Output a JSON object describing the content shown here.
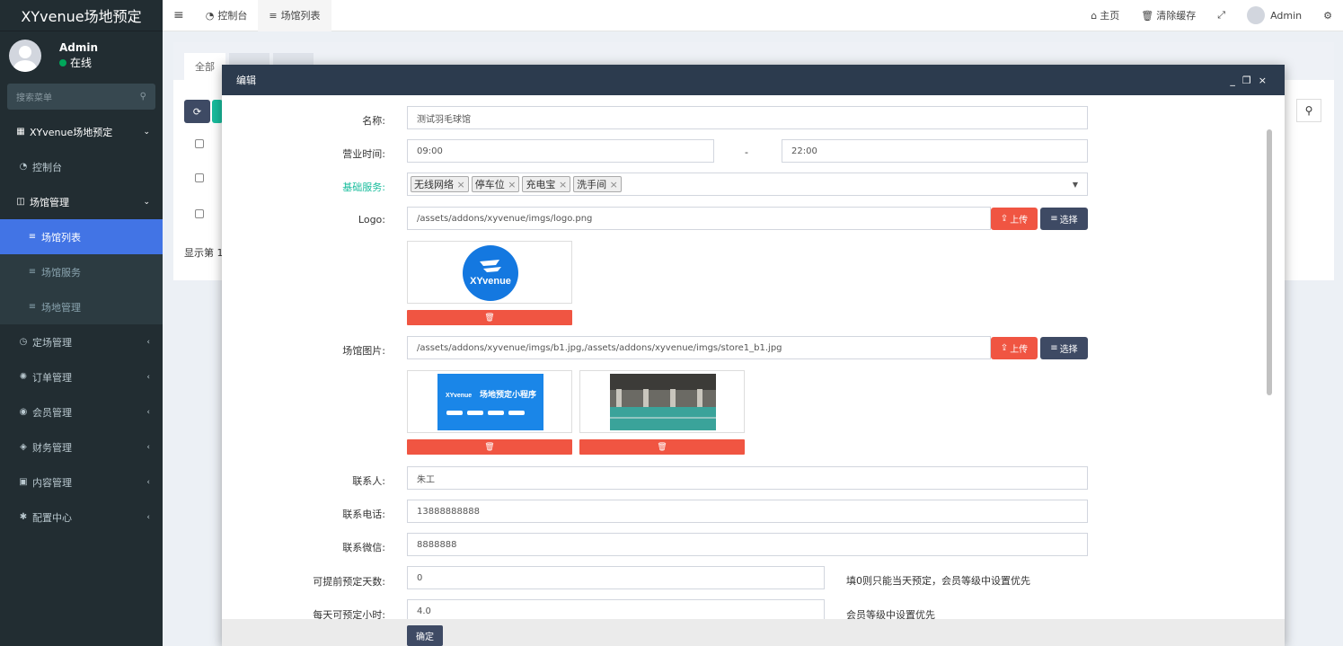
{
  "sidebar": {
    "brand": "XYvenue场地预定",
    "user_name": "Admin",
    "user_status": "在线",
    "search_placeholder": "搜索菜单",
    "items": [
      {
        "label": "XYvenue场地预定",
        "icon": "grid-icon"
      },
      {
        "label": "控制台",
        "icon": "dashboard-icon"
      },
      {
        "label": "场馆管理",
        "icon": "columns-icon"
      },
      {
        "label": "场馆列表",
        "icon": "list-icon"
      },
      {
        "label": "场馆服务",
        "icon": "list-icon"
      },
      {
        "label": "场地管理",
        "icon": "list-icon"
      },
      {
        "label": "定场管理",
        "icon": "clock-icon"
      },
      {
        "label": "订单管理",
        "icon": "gear-icon"
      },
      {
        "label": "会员管理",
        "icon": "user-icon"
      },
      {
        "label": "财务管理",
        "icon": "diamond-icon"
      },
      {
        "label": "内容管理",
        "icon": "edit-icon"
      },
      {
        "label": "配置中心",
        "icon": "cog-icon"
      }
    ]
  },
  "topbar": {
    "menu_icon": "≡",
    "tabs": [
      "控制台",
      "场馆列表"
    ],
    "home": "主页",
    "clear_cache": "清除缓存",
    "admin": "Admin"
  },
  "content": {
    "tab_all": "全部",
    "pager_text": "显示第 1"
  },
  "modal": {
    "title": "编辑",
    "fields": {
      "name_label": "名称:",
      "name_value": "测试羽毛球馆",
      "hours_label": "营业时间:",
      "hours_start": "09:00",
      "hours_sep": "-",
      "hours_end": "22:00",
      "services_label": "基础服务:",
      "services": [
        "无线网络",
        "停车位",
        "充电宝",
        "洗手间"
      ],
      "logo_label": "Logo:",
      "logo_value": "/assets/addons/xyvenue/imgs/logo.png",
      "logo_text": "XYvenue",
      "images_label": "场馆图片:",
      "images_value": "/assets/addons/xyvenue/imgs/b1.jpg,/assets/addons/xyvenue/imgs/store1_b1.jpg",
      "banner_title": "场地预定小程序",
      "contact_label": "联系人:",
      "contact_value": "朱工",
      "phone_label": "联系电话:",
      "phone_value": "13888888888",
      "wechat_label": "联系微信:",
      "wechat_value": "8888888",
      "advance_label": "可提前预定天数:",
      "advance_value": "0",
      "advance_hint": "填0则只能当天预定，会员等级中设置优先",
      "hours_per_day_label": "每天可预定小时:",
      "hours_per_day_value": "4.0",
      "hours_per_day_hint": "会员等级中设置优先"
    },
    "upload_label": "上传",
    "choose_label": "选择",
    "confirm_label": "确定"
  }
}
